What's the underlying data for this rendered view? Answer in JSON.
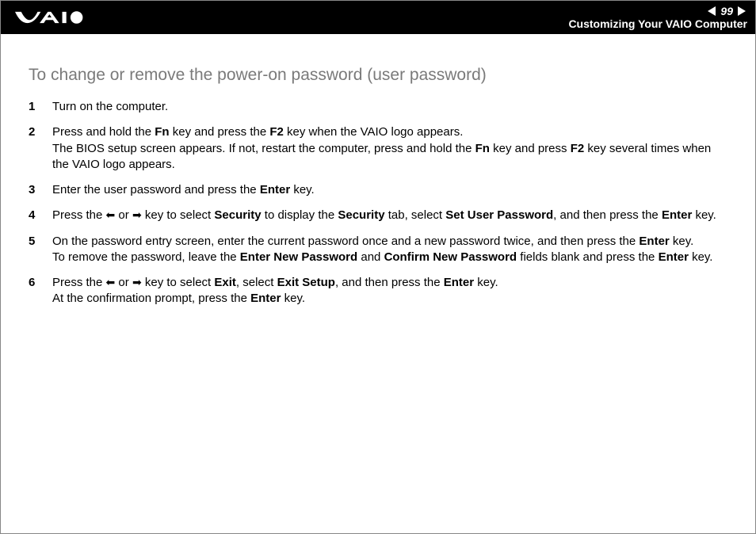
{
  "header": {
    "page_number": "99",
    "section_title": "Customizing Your VAIO Computer"
  },
  "title": "To change or remove the power-on password (user password)",
  "steps": [
    {
      "num": "1",
      "segments": [
        {
          "t": "Turn on the computer."
        }
      ]
    },
    {
      "num": "2",
      "segments": [
        {
          "t": "Press and hold the "
        },
        {
          "t": "Fn",
          "b": true
        },
        {
          "t": " key and press the "
        },
        {
          "t": "F2",
          "b": true
        },
        {
          "t": " key when the VAIO logo appears."
        },
        {
          "br": true
        },
        {
          "t": "The BIOS setup screen appears. If not, restart the computer, press and hold the "
        },
        {
          "t": "Fn",
          "b": true
        },
        {
          "t": " key and press "
        },
        {
          "t": "F2",
          "b": true
        },
        {
          "t": " key several times when the VAIO logo appears."
        }
      ]
    },
    {
      "num": "3",
      "segments": [
        {
          "t": "Enter the user password and press the "
        },
        {
          "t": "Enter",
          "b": true
        },
        {
          "t": " key."
        }
      ]
    },
    {
      "num": "4",
      "segments": [
        {
          "t": "Press the "
        },
        {
          "icon": "arrow-left"
        },
        {
          "t": " or "
        },
        {
          "icon": "arrow-right"
        },
        {
          "t": " key to select "
        },
        {
          "t": "Security",
          "b": true
        },
        {
          "t": " to display the "
        },
        {
          "t": "Security",
          "b": true
        },
        {
          "t": " tab, select "
        },
        {
          "t": "Set User Password",
          "b": true
        },
        {
          "t": ", and then press the "
        },
        {
          "t": "Enter",
          "b": true
        },
        {
          "t": " key."
        }
      ]
    },
    {
      "num": "5",
      "segments": [
        {
          "t": "On the password entry screen, enter the current password once and a new password twice, and then press the "
        },
        {
          "t": "Enter",
          "b": true
        },
        {
          "t": " key."
        },
        {
          "br": true
        },
        {
          "t": "To remove the password, leave the "
        },
        {
          "t": "Enter New Password",
          "b": true
        },
        {
          "t": " and "
        },
        {
          "t": "Confirm New Password",
          "b": true
        },
        {
          "t": " fields blank and press the "
        },
        {
          "t": "Enter",
          "b": true
        },
        {
          "t": " key."
        }
      ]
    },
    {
      "num": "6",
      "segments": [
        {
          "t": "Press the "
        },
        {
          "icon": "arrow-left"
        },
        {
          "t": " or "
        },
        {
          "icon": "arrow-right"
        },
        {
          "t": " key to select "
        },
        {
          "t": "Exit",
          "b": true
        },
        {
          "t": ", select "
        },
        {
          "t": "Exit Setup",
          "b": true
        },
        {
          "t": ", and then press the "
        },
        {
          "t": "Enter",
          "b": true
        },
        {
          "t": " key."
        },
        {
          "br": true
        },
        {
          "t": "At the confirmation prompt, press the "
        },
        {
          "t": "Enter",
          "b": true
        },
        {
          "t": " key."
        }
      ]
    }
  ]
}
